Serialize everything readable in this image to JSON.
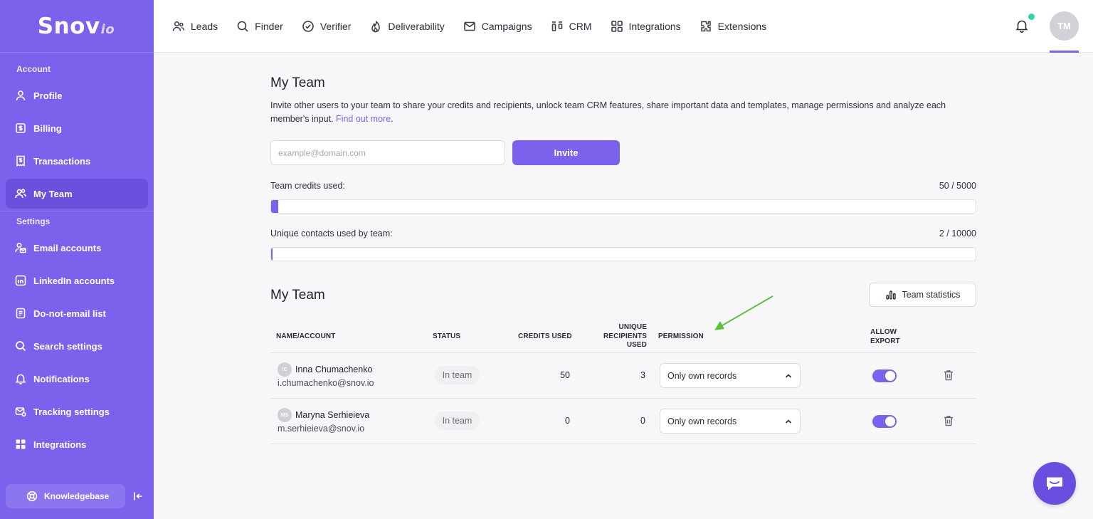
{
  "sidebar": {
    "logo_main": "Snov",
    "logo_sub": "io",
    "account_label": "Account",
    "settings_label": "Settings",
    "account_items": [
      {
        "label": "Profile",
        "icon": "user-icon"
      },
      {
        "label": "Billing",
        "icon": "billing-icon"
      },
      {
        "label": "Transactions",
        "icon": "receipt-icon"
      },
      {
        "label": "My Team",
        "icon": "team-icon",
        "active": true
      }
    ],
    "settings_items": [
      {
        "label": "Email accounts",
        "icon": "email-account-icon"
      },
      {
        "label": "LinkedIn accounts",
        "icon": "linkedin-icon"
      },
      {
        "label": "Do-not-email list",
        "icon": "list-icon"
      },
      {
        "label": "Search settings",
        "icon": "search-icon"
      },
      {
        "label": "Notifications",
        "icon": "bell-icon"
      },
      {
        "label": "Tracking settings",
        "icon": "tracking-icon"
      },
      {
        "label": "Integrations",
        "icon": "grid-icon"
      }
    ],
    "knowledgebase_label": "Knowledgebase"
  },
  "topnav": {
    "items": [
      {
        "label": "Leads",
        "icon": "users-icon"
      },
      {
        "label": "Finder",
        "icon": "search-icon"
      },
      {
        "label": "Verifier",
        "icon": "check-circle-icon"
      },
      {
        "label": "Deliverability",
        "icon": "flame-icon"
      },
      {
        "label": "Campaigns",
        "icon": "mail-icon"
      },
      {
        "label": "CRM",
        "icon": "crm-icon"
      },
      {
        "label": "Integrations",
        "icon": "grid-icon"
      },
      {
        "label": "Extensions",
        "icon": "puzzle-icon"
      }
    ],
    "avatar_initials": "TM"
  },
  "main": {
    "title": "My Team",
    "description": "Invite other users to your team to share your credits and recipients, unlock team CRM features, share important data and templates, manage permissions and analyze each member's input.",
    "find_out_more": "Find out more",
    "invite_placeholder": "example@domain.com",
    "invite_button": "Invite",
    "credits_label": "Team credits used:",
    "credits_value": "50 / 5000",
    "credits_fraction": 0.01,
    "contacts_label": "Unique contacts used by team:",
    "contacts_value": "2 / 10000",
    "contacts_fraction": 0.0002,
    "team_title": "My Team",
    "team_stats_button": "Team statistics",
    "table": {
      "headers": {
        "name": "NAME/ACCOUNT",
        "status": "STATUS",
        "credits": "CREDITS USED",
        "unique_1": "UNIQUE",
        "unique_2": "RECIPIENTS",
        "unique_3": "USED",
        "permission": "PERMISSION",
        "export_1": "ALLOW",
        "export_2": "EXPORT"
      },
      "rows": [
        {
          "initials": "IC",
          "name": "Inna Chumachenko",
          "email": "i.chumachenko@snov.io",
          "status": "In team",
          "credits": "50",
          "recipients": "3",
          "permission": "Only own records",
          "allow_export": true
        },
        {
          "initials": "MS",
          "name": "Maryna Serhieieva",
          "email": "m.serhieieva@snov.io",
          "status": "In team",
          "credits": "0",
          "recipients": "0",
          "permission": "Only own records",
          "allow_export": true
        }
      ]
    }
  },
  "colors": {
    "accent": "#7b61eb",
    "sidebar": "#7b61eb",
    "notification_dot": "#2ed6a7",
    "annotation_arrow": "#5cc23a"
  }
}
